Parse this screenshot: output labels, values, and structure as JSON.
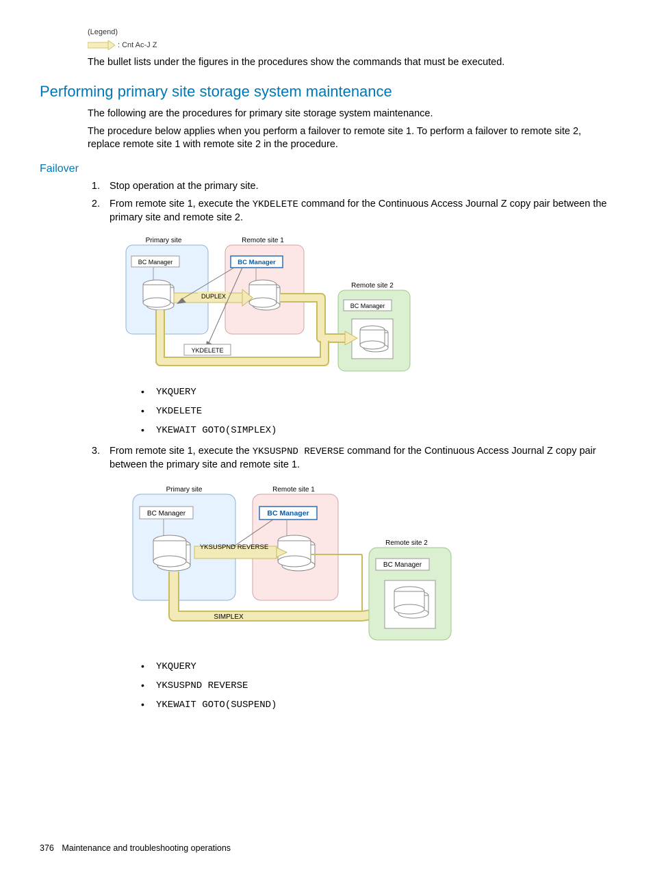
{
  "legend": {
    "title": "(Legend)",
    "item": ": Cnt Ac-J Z"
  },
  "intro": "The bullet lists under the figures in the procedures show the commands that must be executed.",
  "heading_main": "Performing primary site storage system maintenance",
  "para1": "The following are the procedures for primary site storage system maintenance.",
  "para2": "The procedure below applies when you perform a failover to remote site 1. To perform a failover to remote site 2, replace remote site 1 with remote site 2 in the procedure.",
  "heading_sub": "Failover",
  "step1": "Stop operation at the primary site.",
  "step2_a": "From remote site 1, execute the ",
  "step2_cmd": "YKDELETE",
  "step2_b": " command for the Continuous Access Journal Z copy pair between the primary site and remote site 2.",
  "diagram1": {
    "primary": "Primary site",
    "remote1": "Remote site 1",
    "remote2": "Remote site 2",
    "bc": "BC Manager",
    "duplex": "DUPLEX",
    "ykdelete": "YKDELETE"
  },
  "cmds1": {
    "a": "YKQUERY",
    "b": "YKDELETE",
    "c": "YKEWAIT GOTO(SIMPLEX)"
  },
  "step3_a": "From remote site 1, execute the ",
  "step3_cmd": "YKSUSPND REVERSE",
  "step3_b": " command for the Continuous Access Journal Z copy pair between the primary site and remote site 1.",
  "diagram2": {
    "primary": "Primary site",
    "remote1": "Remote site 1",
    "remote2": "Remote site 2",
    "bc": "BC Manager",
    "yksuspnd": "YKSUSPND REVERSE",
    "simplex": "SIMPLEX"
  },
  "cmds2": {
    "a": "YKQUERY",
    "b": "YKSUSPND REVERSE",
    "c": "YKEWAIT GOTO(SUSPEND)"
  },
  "footer": {
    "page": "376",
    "title": "Maintenance and troubleshooting operations"
  }
}
